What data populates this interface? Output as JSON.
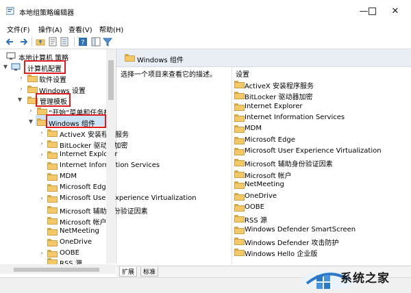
{
  "window": {
    "title": "本地组策略编辑器"
  },
  "menu": [
    "文件(F)",
    "操作(A)",
    "查看(V)",
    "帮助(H)"
  ],
  "toolbar": [
    "back-icon",
    "forward-icon",
    "folder-up-icon",
    "properties-icon",
    "export-list-icon",
    "help-icon",
    "show-pane-icon",
    "filter-icon"
  ],
  "tree": [
    {
      "label": "本地计算机 策略",
      "icon": "computer-policy-icon"
    },
    {
      "label": "计算机配置",
      "icon": "computer-icon"
    },
    {
      "label": "软件设置",
      "icon": "folder-icon"
    },
    {
      "label": "Windows 设置",
      "icon": "folder-icon"
    },
    {
      "label": "管理模板",
      "icon": "folder-icon"
    },
    {
      "label": "“开始”菜单和任务栏",
      "icon": "folder-icon"
    },
    {
      "label": "Windows 组件",
      "icon": "folder-open-icon"
    },
    {
      "label": "ActiveX 安装程序服务",
      "icon": "folder-icon"
    },
    {
      "label": "BitLocker 驱动器加密",
      "icon": "folder-icon"
    },
    {
      "label": "Internet Explorer",
      "icon": "folder-icon"
    },
    {
      "label": "Internet Information Services",
      "icon": "folder-icon"
    },
    {
      "label": "MDM",
      "icon": "folder-icon"
    },
    {
      "label": "Microsoft Edge",
      "icon": "folder-icon"
    },
    {
      "label": "Microsoft User Experience Virtualization",
      "icon": "folder-icon"
    },
    {
      "label": "Microsoft 辅助身份验证因素",
      "icon": "folder-icon"
    },
    {
      "label": "Microsoft 帐户",
      "icon": "folder-icon"
    },
    {
      "label": "NetMeeting",
      "icon": "folder-icon"
    },
    {
      "label": "OneDrive",
      "icon": "folder-icon"
    },
    {
      "label": "OOBE",
      "icon": "folder-icon"
    },
    {
      "label": "RSS 源",
      "icon": "folder-icon"
    }
  ],
  "right": {
    "header": "Windows 组件",
    "description": "选择一个项目来查看它的描述。",
    "column": "设置",
    "items": [
      "ActiveX 安装程序服务",
      "BitLocker 驱动器加密",
      "Internet Explorer",
      "Internet Information Services",
      "MDM",
      "Microsoft Edge",
      "Microsoft User Experience Virtualization",
      "Microsoft 辅助身份验证因素",
      "Microsoft 帐户",
      "NetMeeting",
      "OneDrive",
      "OOBE",
      "RSS 源",
      "Windows Defender SmartScreen",
      "Windows Defender 攻击防护",
      "Windows Hello 企业版"
    ]
  },
  "tabs": [
    "扩展",
    "标准"
  ],
  "watermark": {
    "text": "系统之家"
  }
}
